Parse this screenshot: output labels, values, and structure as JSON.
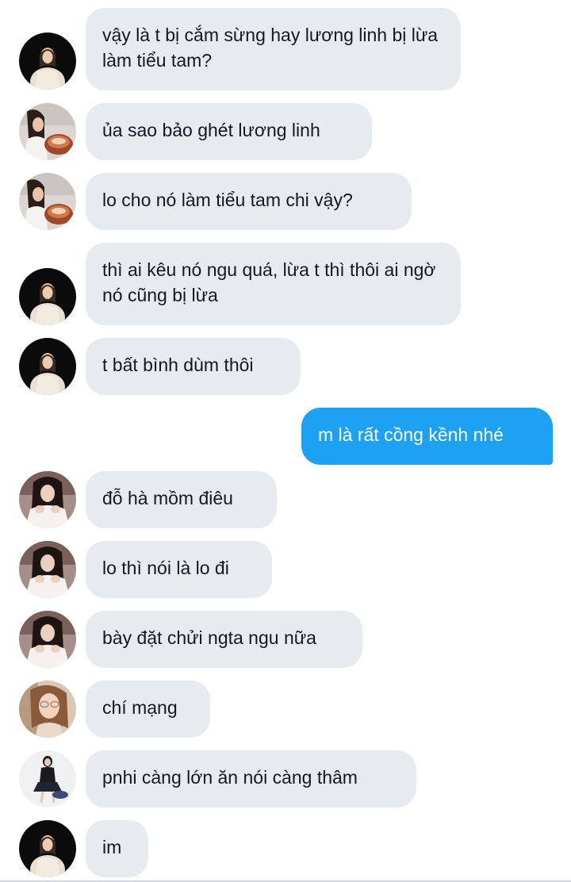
{
  "colors": {
    "incoming_bubble": "#e6ebf0",
    "outgoing_bubble": "#1da1f2",
    "incoming_text": "#141823",
    "outgoing_text": "#ffffff"
  },
  "messages": [
    {
      "direction": "incoming",
      "avatar": "avatar-dark-girl",
      "text": "vậy là t bị cắm sừng hay lương linh bị lừa làm tiểu tam?"
    },
    {
      "direction": "incoming",
      "avatar": "avatar-girl-food",
      "text": "ủa sao bảo ghét lương linh"
    },
    {
      "direction": "incoming",
      "avatar": "avatar-girl-food",
      "text": "lo cho nó làm tiểu tam chi vậy?"
    },
    {
      "direction": "incoming",
      "avatar": "avatar-dark-girl",
      "text": "thì ai kêu nó ngu quá, lừa t thì thôi ai ngờ nó cũng bị lừa"
    },
    {
      "direction": "incoming",
      "avatar": "avatar-dark-girl",
      "text": "t bất bình dùm thôi"
    },
    {
      "direction": "outgoing",
      "avatar": "",
      "text": "m là rất cồng kềnh nhé"
    },
    {
      "direction": "incoming",
      "avatar": "avatar-girl-white-sweater",
      "text": "đỗ hà mồm điêu"
    },
    {
      "direction": "incoming",
      "avatar": "avatar-girl-white-sweater",
      "text": "lo thì nói là lo đi"
    },
    {
      "direction": "incoming",
      "avatar": "avatar-girl-white-sweater",
      "text": "bày đặt chửi ngta ngu nữa"
    },
    {
      "direction": "incoming",
      "avatar": "avatar-girl-glasses",
      "text": "chí mạng"
    },
    {
      "direction": "incoming",
      "avatar": "avatar-girl-black-dress",
      "text": "pnhi càng lớn ăn nói càng thâm"
    },
    {
      "direction": "incoming",
      "avatar": "avatar-dark-girl",
      "text": "im"
    }
  ]
}
